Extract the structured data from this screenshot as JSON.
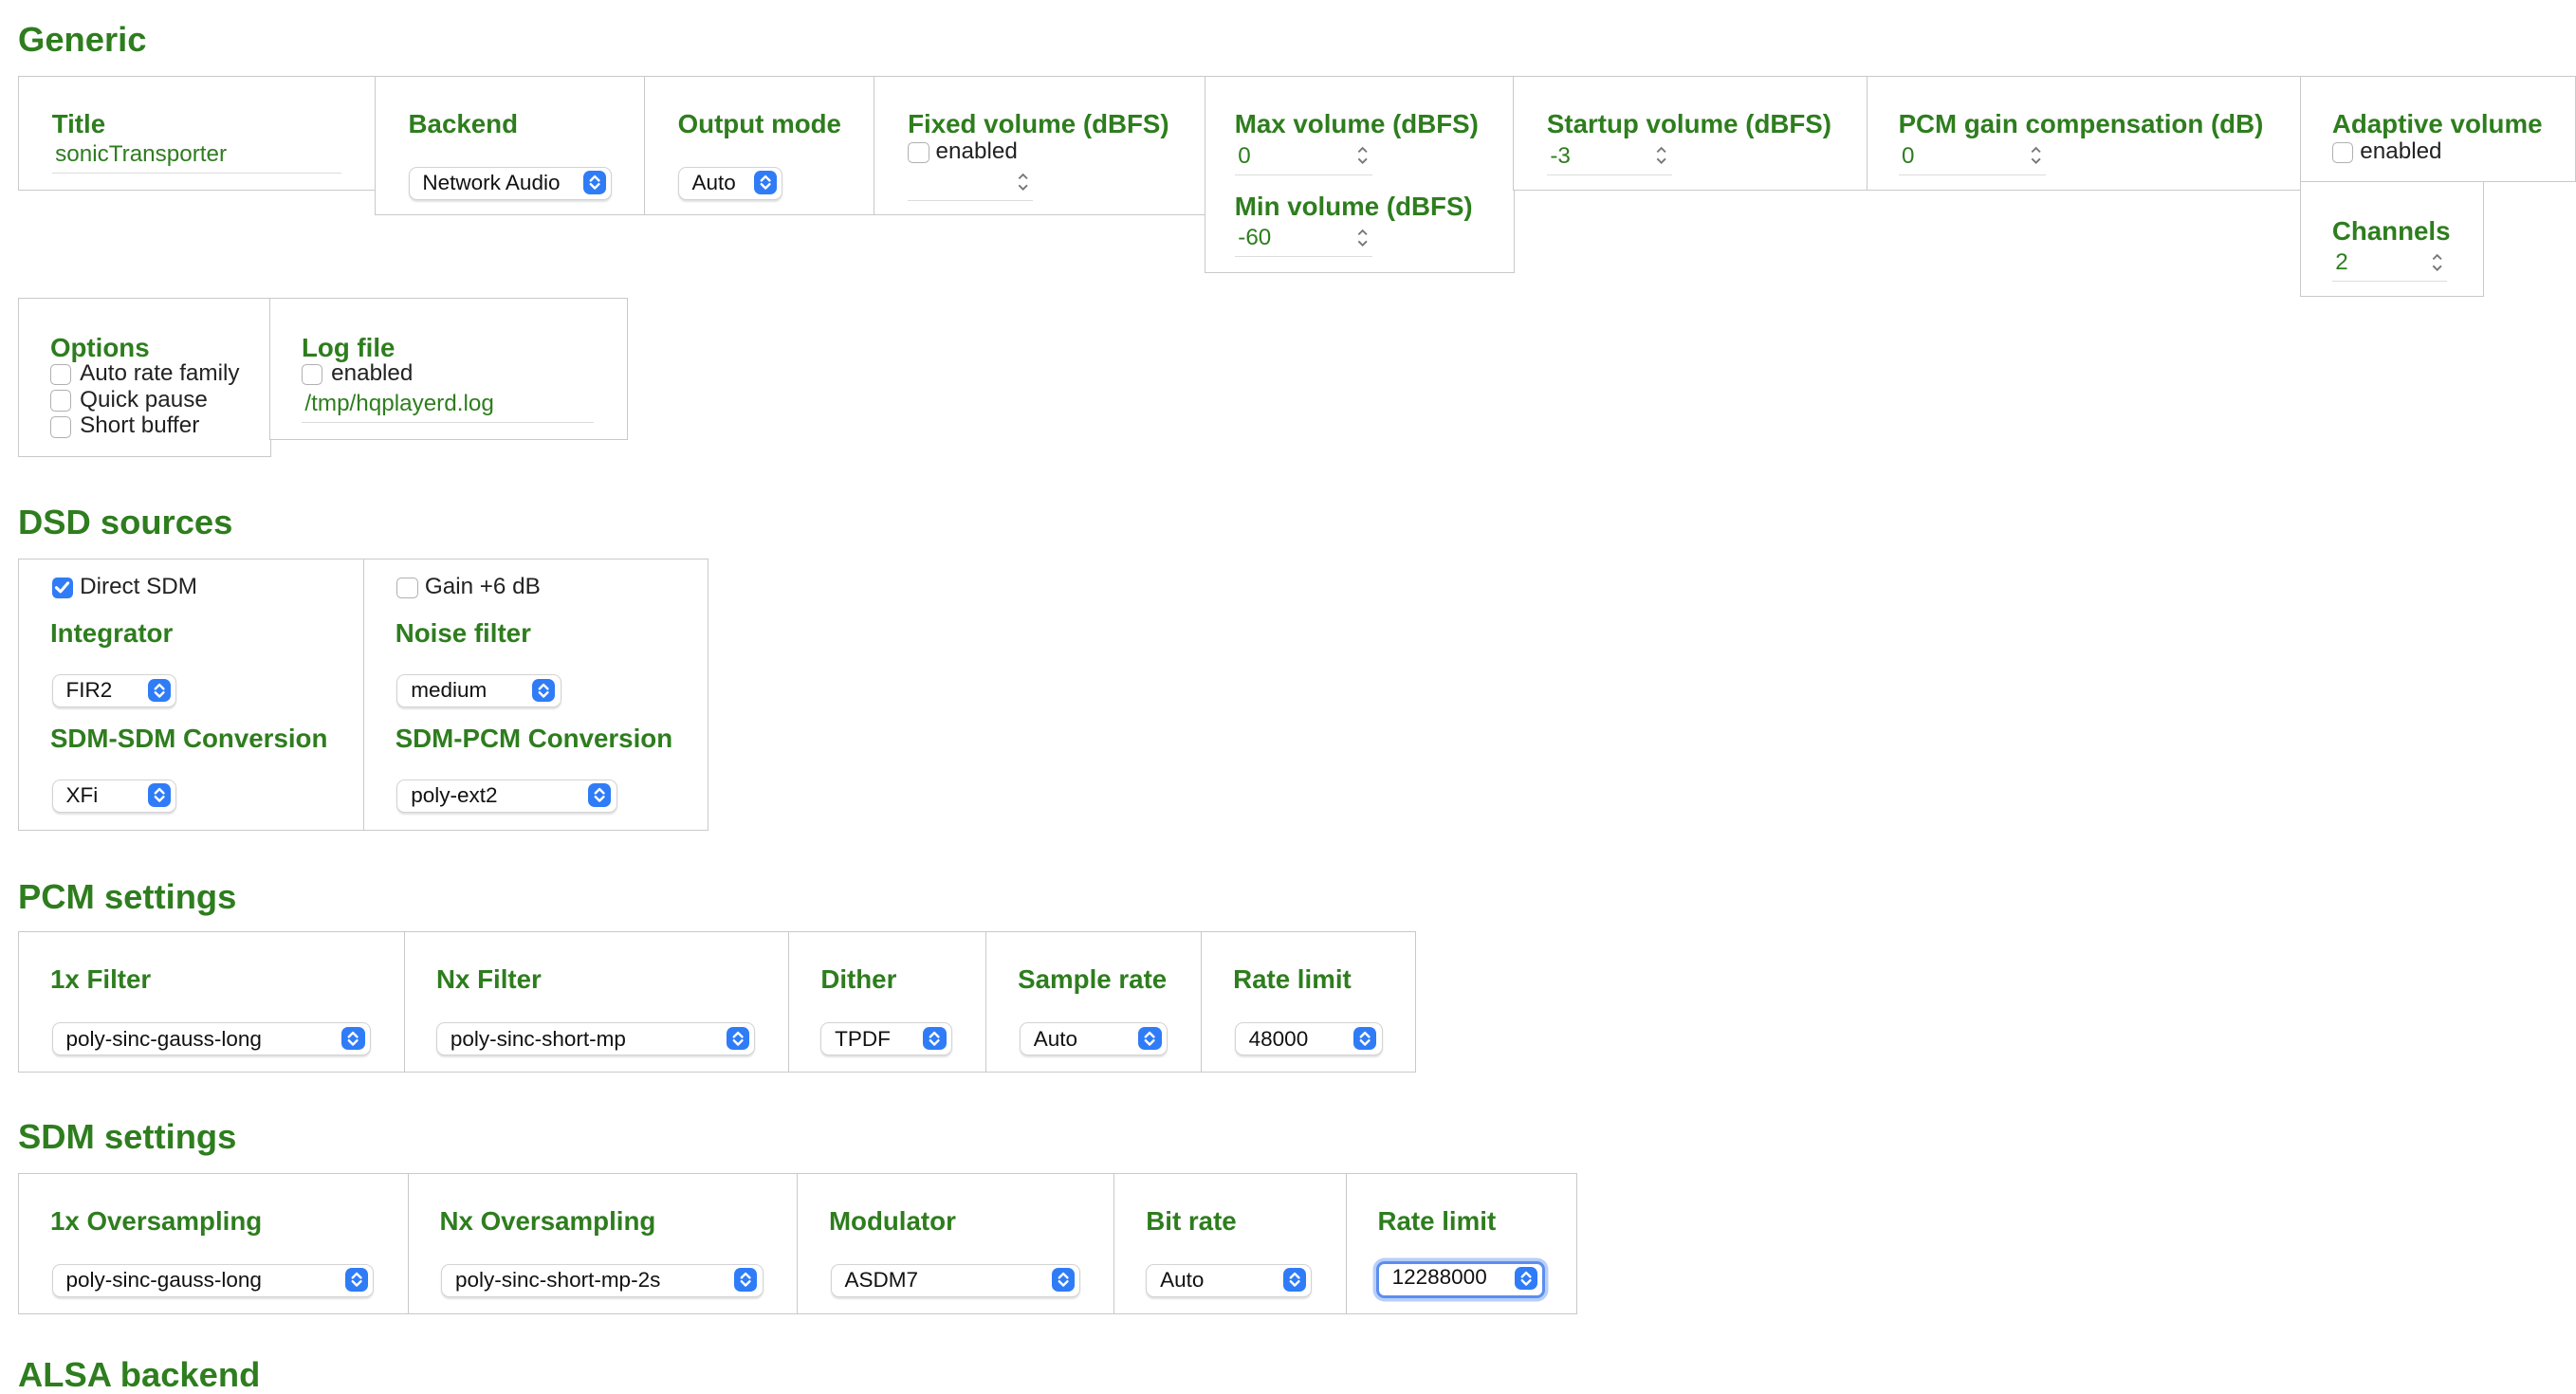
{
  "colors": {
    "accent_green": "#2e7d1e",
    "select_blue": "#2f7cf6",
    "border": "#c9c9c9"
  },
  "icons": {
    "select_arrow": "chevron-up-down-icon",
    "spinner": "stepper-icon",
    "checkbox": "checkbox-icon"
  },
  "generic": {
    "heading": "Generic",
    "title": {
      "label": "Title",
      "value": "sonicTransporter"
    },
    "backend": {
      "label": "Backend",
      "value": "Network Audio"
    },
    "output_mode": {
      "label": "Output mode",
      "value": "Auto"
    },
    "fixed_volume": {
      "label": "Fixed volume (dBFS)",
      "enabled_label": "enabled",
      "enabled": false,
      "value": ""
    },
    "max_volume": {
      "label": "Max volume (dBFS)",
      "value": "0"
    },
    "min_volume": {
      "label": "Min volume (dBFS)",
      "value": "-60"
    },
    "startup_volume": {
      "label": "Startup volume (dBFS)",
      "value": "-3"
    },
    "pcm_gain": {
      "label": "PCM gain compensation (dB)",
      "value": "0"
    },
    "adaptive_volume": {
      "label": "Adaptive volume",
      "enabled_label": "enabled",
      "enabled": false
    },
    "channels": {
      "label": "Channels",
      "value": "2"
    },
    "options": {
      "label": "Options",
      "items": [
        {
          "label": "Auto rate family",
          "checked": false
        },
        {
          "label": "Quick pause",
          "checked": false
        },
        {
          "label": "Short buffer",
          "checked": false
        }
      ]
    },
    "log_file": {
      "label": "Log file",
      "enabled_label": "enabled",
      "enabled": false,
      "value": "/tmp/hqplayerd.log"
    }
  },
  "dsd": {
    "heading": "DSD sources",
    "direct_sdm": {
      "label": "Direct SDM",
      "checked": true
    },
    "gain": {
      "label": "Gain +6 dB",
      "checked": false
    },
    "integrator": {
      "label": "Integrator",
      "value": "FIR2"
    },
    "noise_filter": {
      "label": "Noise filter",
      "value": "medium"
    },
    "sdm_sdm": {
      "label": "SDM-SDM Conversion",
      "value": "XFi"
    },
    "sdm_pcm": {
      "label": "SDM-PCM Conversion",
      "value": "poly-ext2"
    }
  },
  "pcm": {
    "heading": "PCM settings",
    "filter_1x": {
      "label": "1x Filter",
      "value": "poly-sinc-gauss-long"
    },
    "filter_nx": {
      "label": "Nx Filter",
      "value": "poly-sinc-short-mp"
    },
    "dither": {
      "label": "Dither",
      "value": "TPDF"
    },
    "sample_rate": {
      "label": "Sample rate",
      "value": "Auto"
    },
    "rate_limit": {
      "label": "Rate limit",
      "value": "48000"
    }
  },
  "sdm": {
    "heading": "SDM settings",
    "oversampling_1x": {
      "label": "1x Oversampling",
      "value": "poly-sinc-gauss-long"
    },
    "oversampling_nx": {
      "label": "Nx Oversampling",
      "value": "poly-sinc-short-mp-2s"
    },
    "modulator": {
      "label": "Modulator",
      "value": "ASDM7"
    },
    "bit_rate": {
      "label": "Bit rate",
      "value": "Auto"
    },
    "rate_limit": {
      "label": "Rate limit",
      "value": "12288000"
    }
  },
  "alsa": {
    "heading": "ALSA backend"
  }
}
